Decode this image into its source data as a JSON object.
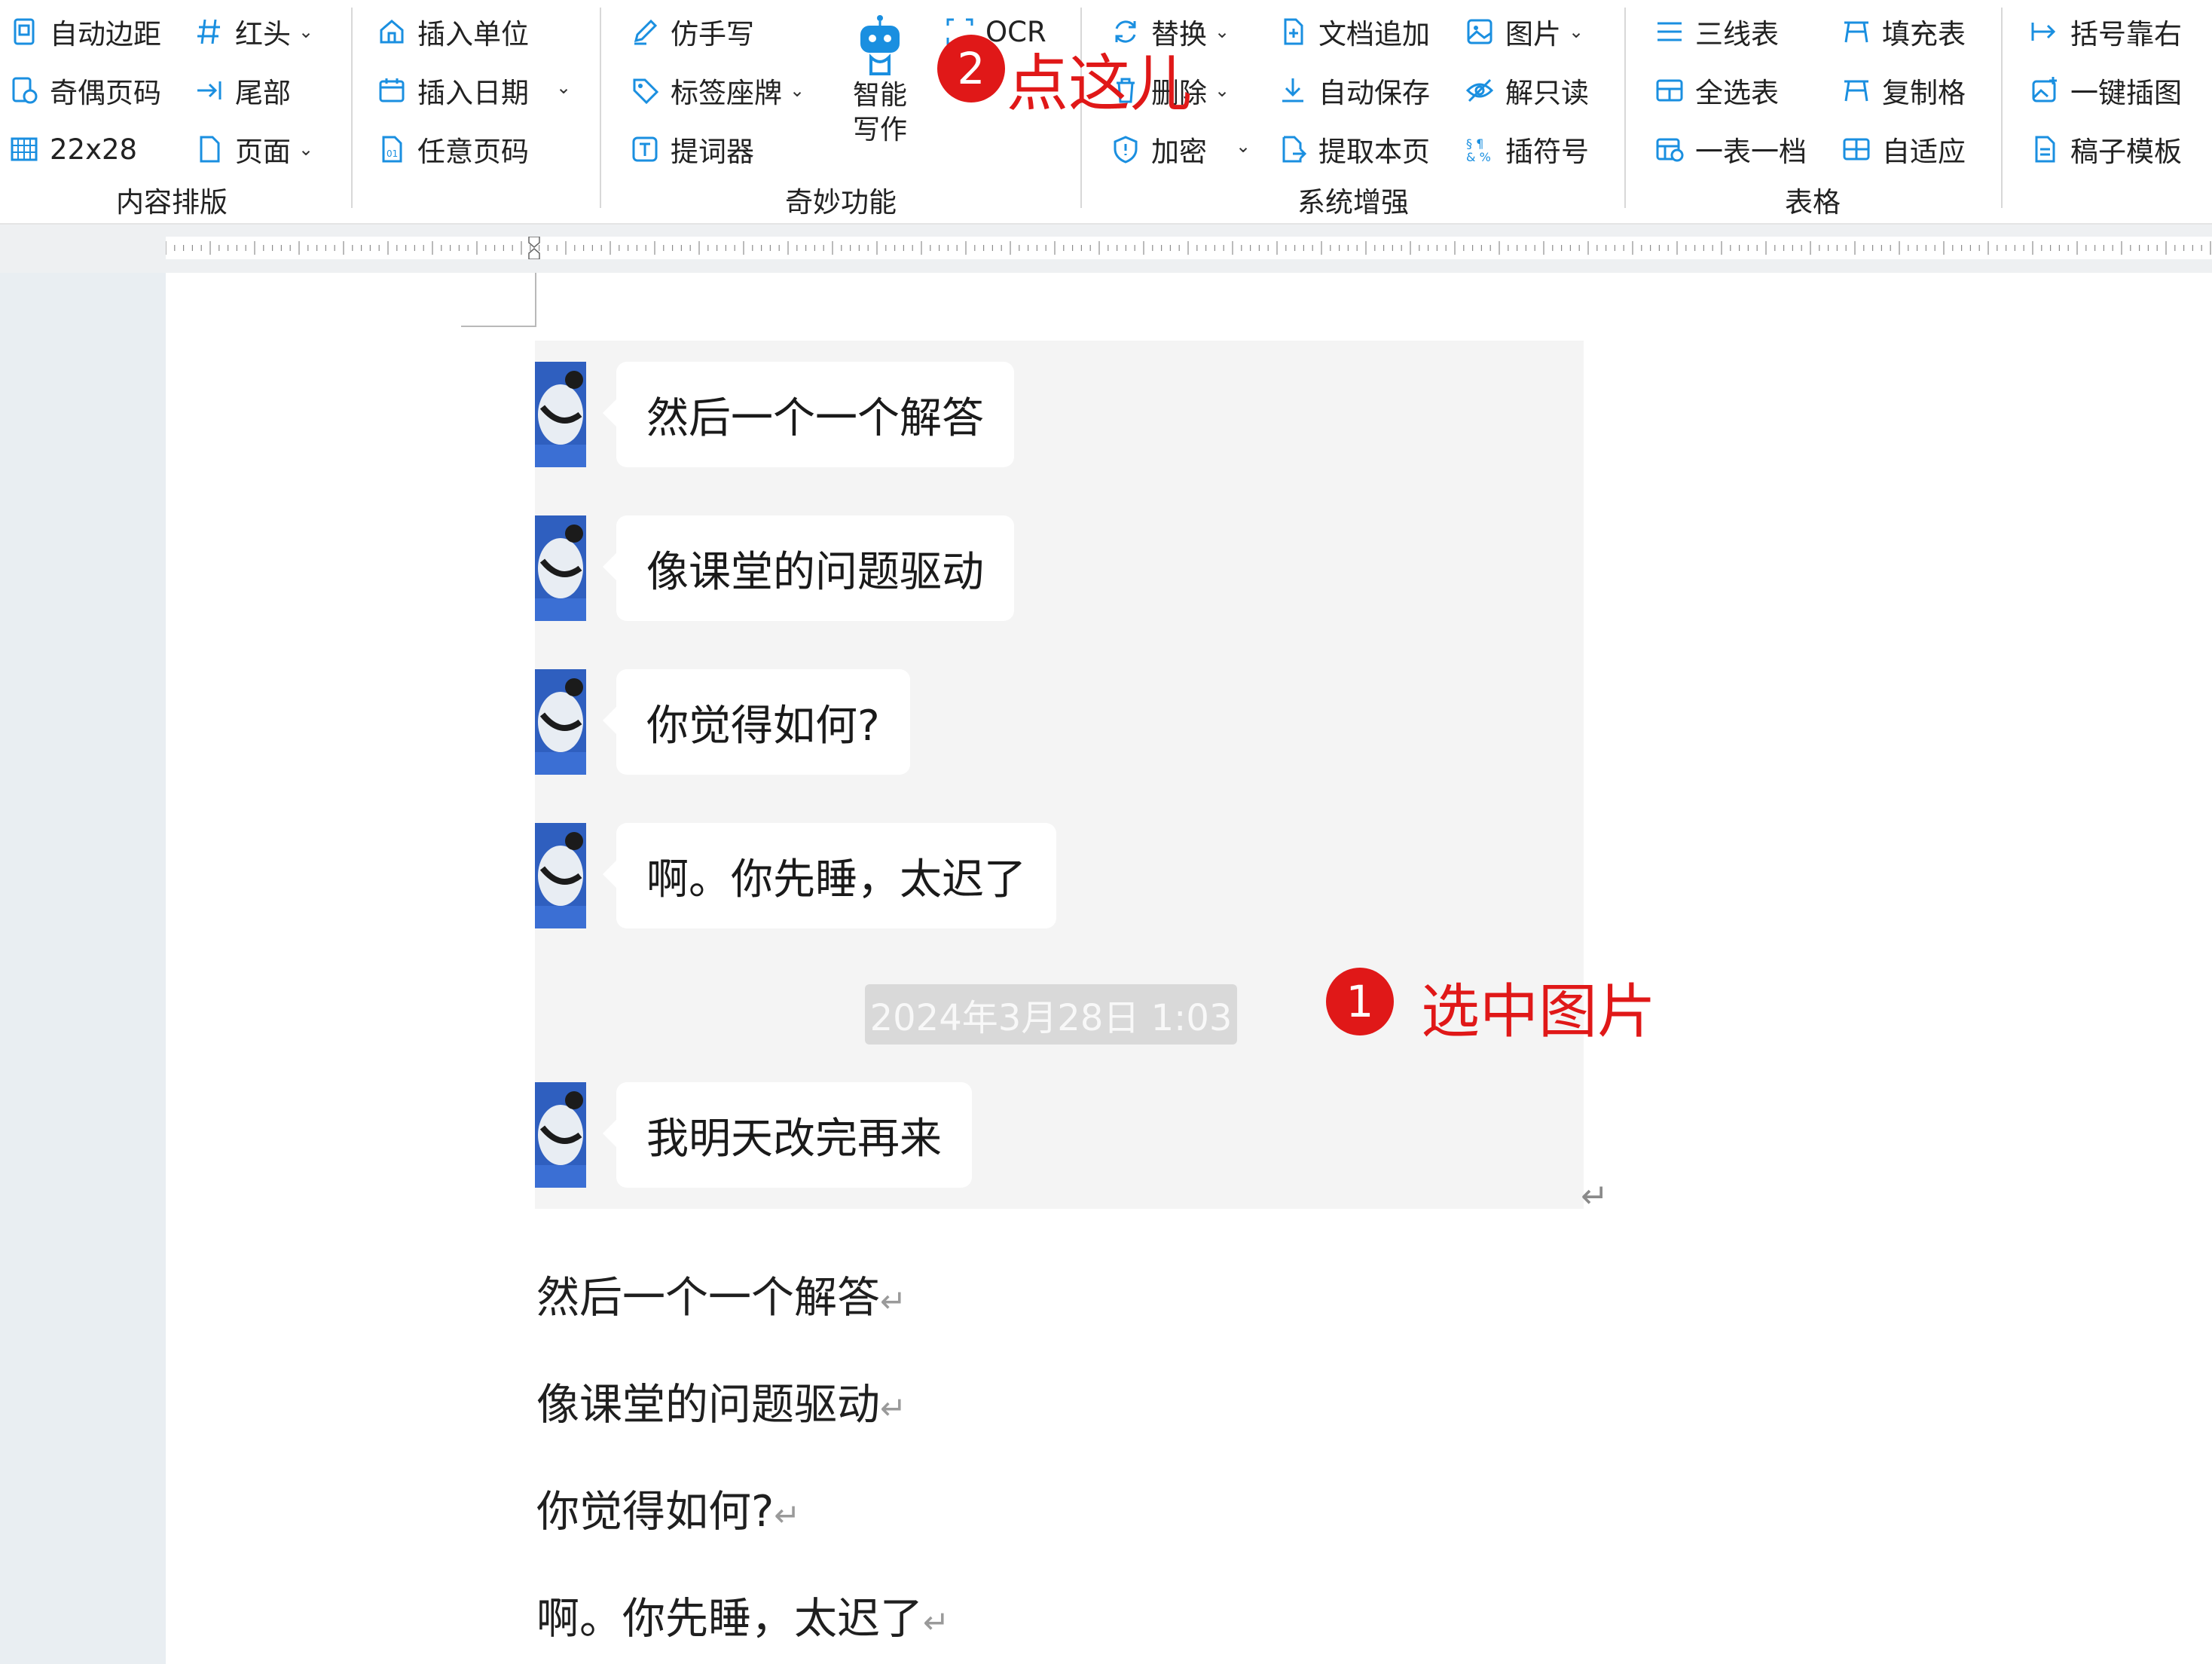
{
  "ribbon": {
    "groups": {
      "content_layout": "内容排版",
      "magic": "奇妙功能",
      "system": "系统增强",
      "table": "表格"
    },
    "items": {
      "auto_margin": "自动边距",
      "red_head": "红头",
      "odd_even_page": "奇偶页码",
      "tail": "尾部",
      "grid_size": "22x28",
      "page": "页面",
      "insert_unit": "插入单位",
      "insert_date": "插入日期",
      "any_page_number": "任意页码",
      "imitate_handwriting": "仿手写",
      "tag_seat_card": "标签座牌",
      "teleprompter": "提词器",
      "smart_writing_1": "智能",
      "smart_writing_2": "写作",
      "ocr": "OCR",
      "replace": "替换",
      "delete": "删除",
      "encrypt": "加密",
      "doc_append": "文档追加",
      "auto_save": "自动保存",
      "extract_page": "提取本页",
      "picture": "图片",
      "unlock_readonly": "解只读",
      "insert_symbol": "插符号",
      "three_line_table": "三线表",
      "select_all_table": "全选表",
      "one_table_one_file": "一表一档",
      "fill_table": "填充表",
      "copy_cell": "复制格",
      "auto_fit": "自适应",
      "bracket_right": "括号靠右",
      "one_click_insert_image": "一键插图",
      "manuscript_template": "稿子模板"
    }
  },
  "chat": {
    "messages": [
      "然后一个一个解答",
      "像课堂的问题驱动",
      "你觉得如何?",
      "啊。你先睡，太迟了",
      "我明天改完再来"
    ],
    "timestamp": "2024年3月28日 1:03"
  },
  "document": {
    "lines": [
      "然后一个一个解答",
      "像课堂的问题驱动",
      "你觉得如何?",
      "啊。你先睡，太迟了"
    ],
    "paragraph_mark": "↵"
  },
  "annotations": {
    "step1_number": "1",
    "step1_text": "选中图片",
    "step2_number": "2",
    "step2_text": "点这儿"
  },
  "colors": {
    "icon_blue": "#1a8fe0",
    "annotation_red": "#e01818",
    "chat_background": "#f4f4f4"
  }
}
